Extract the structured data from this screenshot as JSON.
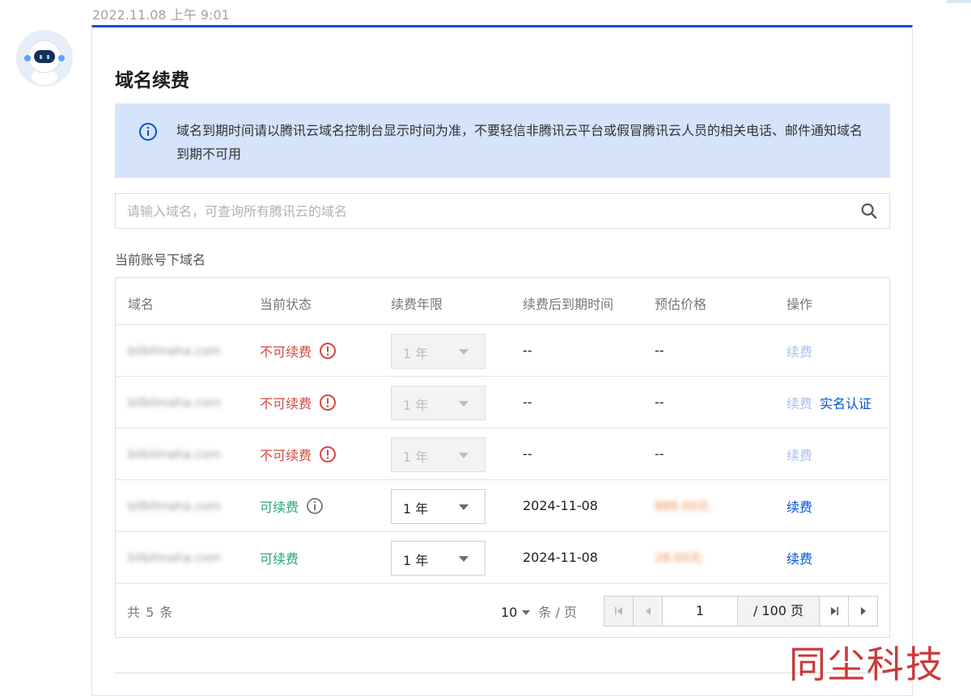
{
  "timestamp": "2022.11.08 上午 9:01",
  "card": {
    "title": "域名续费",
    "notice": "域名到期时间请以腾讯云域名控制台显示时间为准，不要轻信非腾讯云平台或假冒腾讯云人员的相关电话、邮件通知域名到期不可用",
    "search_placeholder": "请输入域名，可查询所有腾讯云的域名",
    "section_label": "当前账号下域名"
  },
  "table": {
    "headers": [
      "域名",
      "当前状态",
      "续费年限",
      "续费后到期时间",
      "预估价格",
      "操作"
    ],
    "rows": [
      {
        "domain": "bilbilmaha.com",
        "status": "不可续费",
        "status_type": "bad",
        "status_icon": "exclamation-circle-icon",
        "years": "1 年",
        "select_disabled": true,
        "expiry": "--",
        "price": "--",
        "action": "续费",
        "action_disabled": true,
        "extra_action": ""
      },
      {
        "domain": "bilbilmaha.com",
        "status": "不可续费",
        "status_type": "bad",
        "status_icon": "exclamation-circle-icon",
        "years": "1 年",
        "select_disabled": true,
        "expiry": "--",
        "price": "--",
        "action": "续费",
        "action_disabled": true,
        "extra_action": "实名认证"
      },
      {
        "domain": "bilbilmaha.com",
        "status": "不可续费",
        "status_type": "bad",
        "status_icon": "exclamation-circle-icon",
        "years": "1 年",
        "select_disabled": true,
        "expiry": "--",
        "price": "--",
        "action": "续费",
        "action_disabled": true,
        "extra_action": ""
      },
      {
        "domain": "bilbilmaha.com",
        "status": "可续费",
        "status_type": "ok",
        "status_icon": "info-circle-icon",
        "years": "1 年",
        "select_disabled": false,
        "expiry": "2024-11-08",
        "price": "888.00元",
        "action": "续费",
        "action_disabled": false,
        "extra_action": ""
      },
      {
        "domain": "bilbilmaha.com",
        "status": "可续费",
        "status_type": "ok",
        "status_icon": "",
        "years": "1 年",
        "select_disabled": false,
        "expiry": "2024-11-08",
        "price": "28.00元",
        "action": "续费",
        "action_disabled": false,
        "extra_action": ""
      }
    ]
  },
  "pagination": {
    "total_text": "共 5  条",
    "page_size": "10",
    "page_size_unit": "条 / 页",
    "current_page": "1",
    "total_pages": "/ 100 页"
  },
  "watermark": "同尘科技",
  "colors": {
    "primary": "#0052d9",
    "danger": "#d54941",
    "success": "#2ba471",
    "notice_bg": "#d5e3fb",
    "watermark": "#c93a3a"
  }
}
